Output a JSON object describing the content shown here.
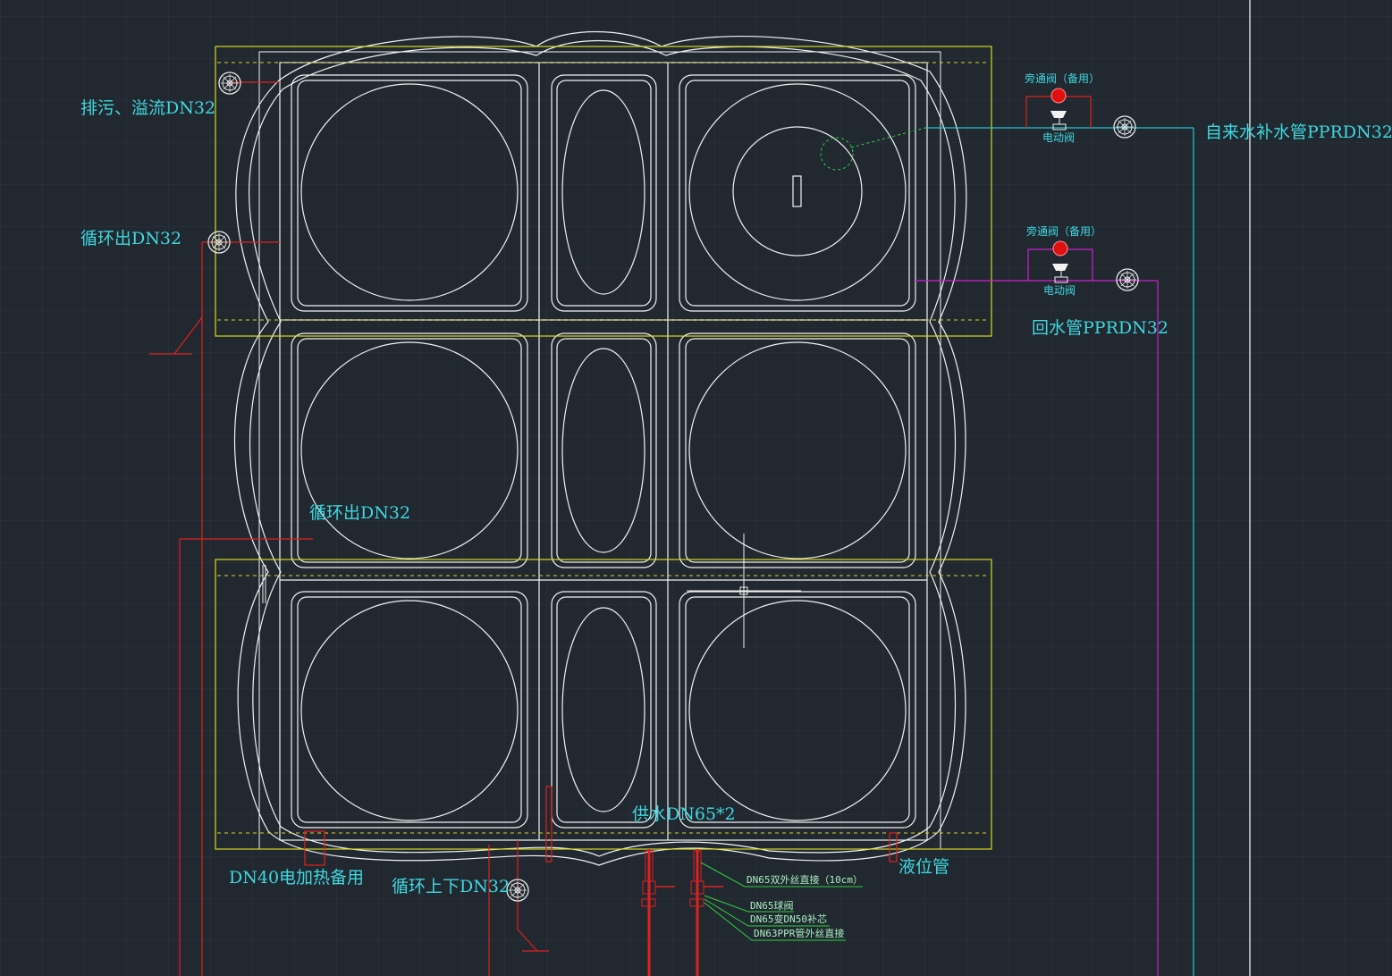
{
  "colors": {
    "background": "#212830",
    "grid": "#2d3540",
    "tank": "#f2f2f2",
    "frame": "#d8d820",
    "drain_pipe": "#e02020",
    "supply_pipe": "#20c8d0",
    "return_pipe": "#d020d0",
    "label": "#3fd8e0",
    "annotation": "#a8f0c0"
  },
  "labels": {
    "drain_overflow": "排污、溢流DN32",
    "circ_out_top": "循环出DN32",
    "circ_out_mid": "循环出DN32",
    "water_supply": "供水DN65*2",
    "heater": "DN40电加热备用",
    "circ_updown": "循环上下DN32",
    "level_pipe": "液位管",
    "tap_water": "自来水补水管PPRDN32",
    "return_pipe": "回水管PPRDN32",
    "bypass_top": "旁通阀（备用）",
    "motor_valve_top": "电动阀",
    "bypass_bottom": "旁通阀（备用）",
    "motor_valve_bottom": "电动阀"
  },
  "annotations": {
    "a1": "DN65双外丝直接（10cm）",
    "a2": "DN65球阀",
    "a3": "DN65变DN50补芯",
    "a4": "DN63PPR管外丝直接"
  },
  "icons": [
    "valve-symbol-icon",
    "pipe-fitting-icon",
    "cursor-crosshair-icon"
  ]
}
